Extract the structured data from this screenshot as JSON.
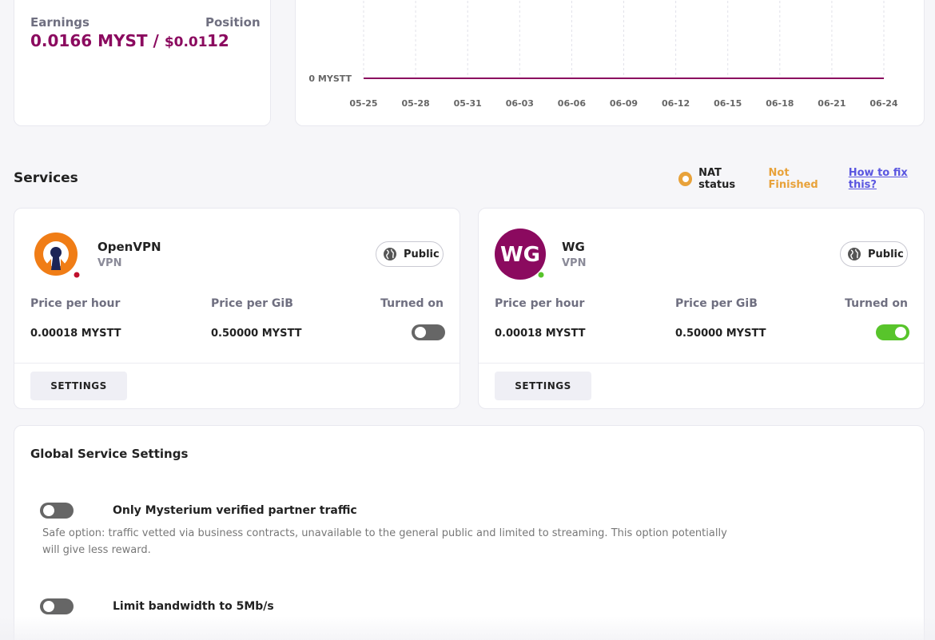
{
  "earnings": {
    "label": "Earnings",
    "value_myst": "0.0166 MYST /",
    "value_usd": "$0.01",
    "position_label": "Position",
    "position_value": "12"
  },
  "chart_data": {
    "type": "line",
    "x": [
      "05-25",
      "05-28",
      "05-31",
      "06-03",
      "06-06",
      "06-09",
      "06-12",
      "06-15",
      "06-18",
      "06-21",
      "06-24"
    ],
    "series": [
      {
        "values": [
          0,
          0,
          0,
          0,
          0,
          0,
          0,
          0,
          0,
          0,
          0.0166
        ]
      }
    ],
    "ytick_label": "0 MYSTT",
    "color": "#8b0a5f",
    "grid": "vertical dashed"
  },
  "services": {
    "title": "Services",
    "nat_label": "NAT status",
    "nat_value": "Not Finished",
    "nat_link": "How to fix this?",
    "nat_color": "#e8a23a",
    "cards": [
      {
        "name": "OpenVPN",
        "type": "VPN",
        "public_label": "Public",
        "price_hour_label": "Price per hour",
        "price_hour": "0.00018 MYSTT",
        "price_gib_label": "Price per GiB",
        "price_gib": "0.50000 MYSTT",
        "turned_on_label": "Turned on",
        "turned_on": false,
        "settings_label": "SETTINGS",
        "status_color": "#c0102d",
        "icon": "openvpn-logo"
      },
      {
        "name": "WG",
        "type": "VPN",
        "avatar_text": "WG",
        "public_label": "Public",
        "price_hour_label": "Price per hour",
        "price_hour": "0.00018 MYSTT",
        "price_gib_label": "Price per GiB",
        "price_gib": "0.50000 MYSTT",
        "turned_on_label": "Turned on",
        "turned_on": true,
        "settings_label": "SETTINGS",
        "status_color": "#58c42b",
        "avatar_color": "#8b0a5f"
      }
    ]
  },
  "global_settings": {
    "title": "Global Service Settings",
    "options": [
      {
        "title": "Only Mysterium verified partner traffic",
        "description": "Safe option: traffic vetted via business contracts, unavailable to the general public and limited to streaming. This option potentially will give less reward.",
        "enabled": false
      },
      {
        "title": "Limit bandwidth to 5Mb/s",
        "enabled": false
      }
    ]
  }
}
